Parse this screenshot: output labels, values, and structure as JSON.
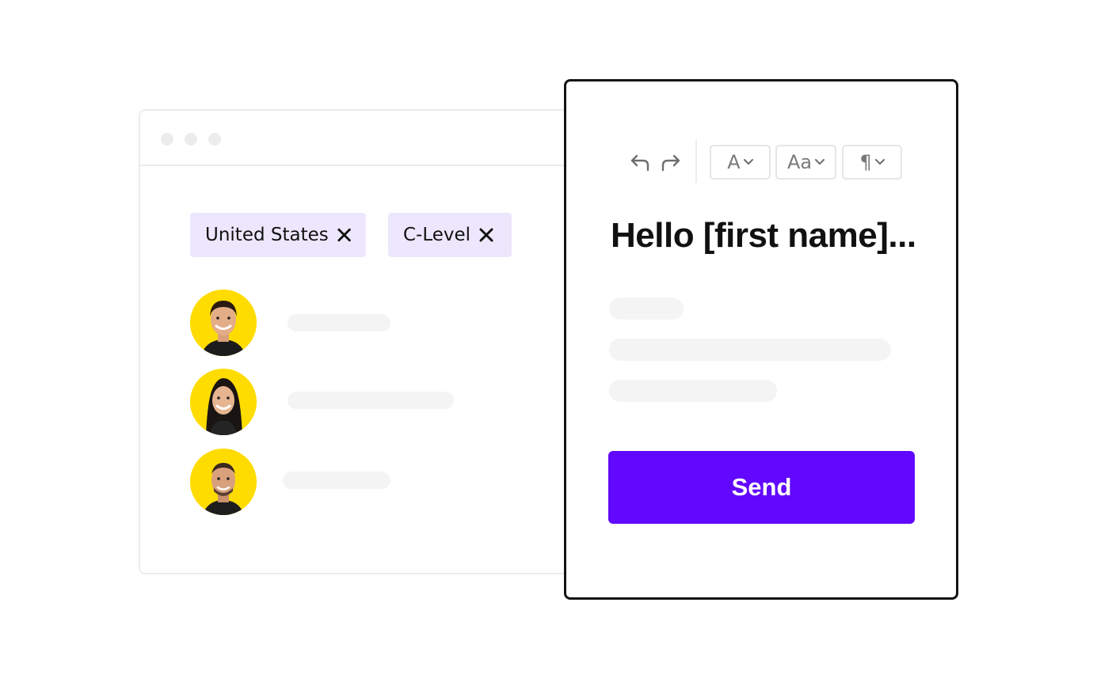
{
  "filters": {
    "chips": [
      {
        "label": "United States",
        "remove_icon": "close-icon"
      },
      {
        "label": "C-Level",
        "remove_icon": "close-icon"
      }
    ]
  },
  "contacts": {
    "avatar_background": "#ffdc00",
    "count": 3
  },
  "composer": {
    "toolbar": {
      "undo_icon": "undo-icon",
      "redo_icon": "redo-icon",
      "font_dropdown_label": "A",
      "size_dropdown_label": "Aa",
      "paragraph_dropdown_label": "¶"
    },
    "greeting": "Hello [first name]...",
    "send_label": "Send"
  },
  "colors": {
    "accent": "#6208ff",
    "chip_background": "#ede7fd",
    "border_dark": "#141414",
    "placeholder": "#f4f4f4"
  }
}
